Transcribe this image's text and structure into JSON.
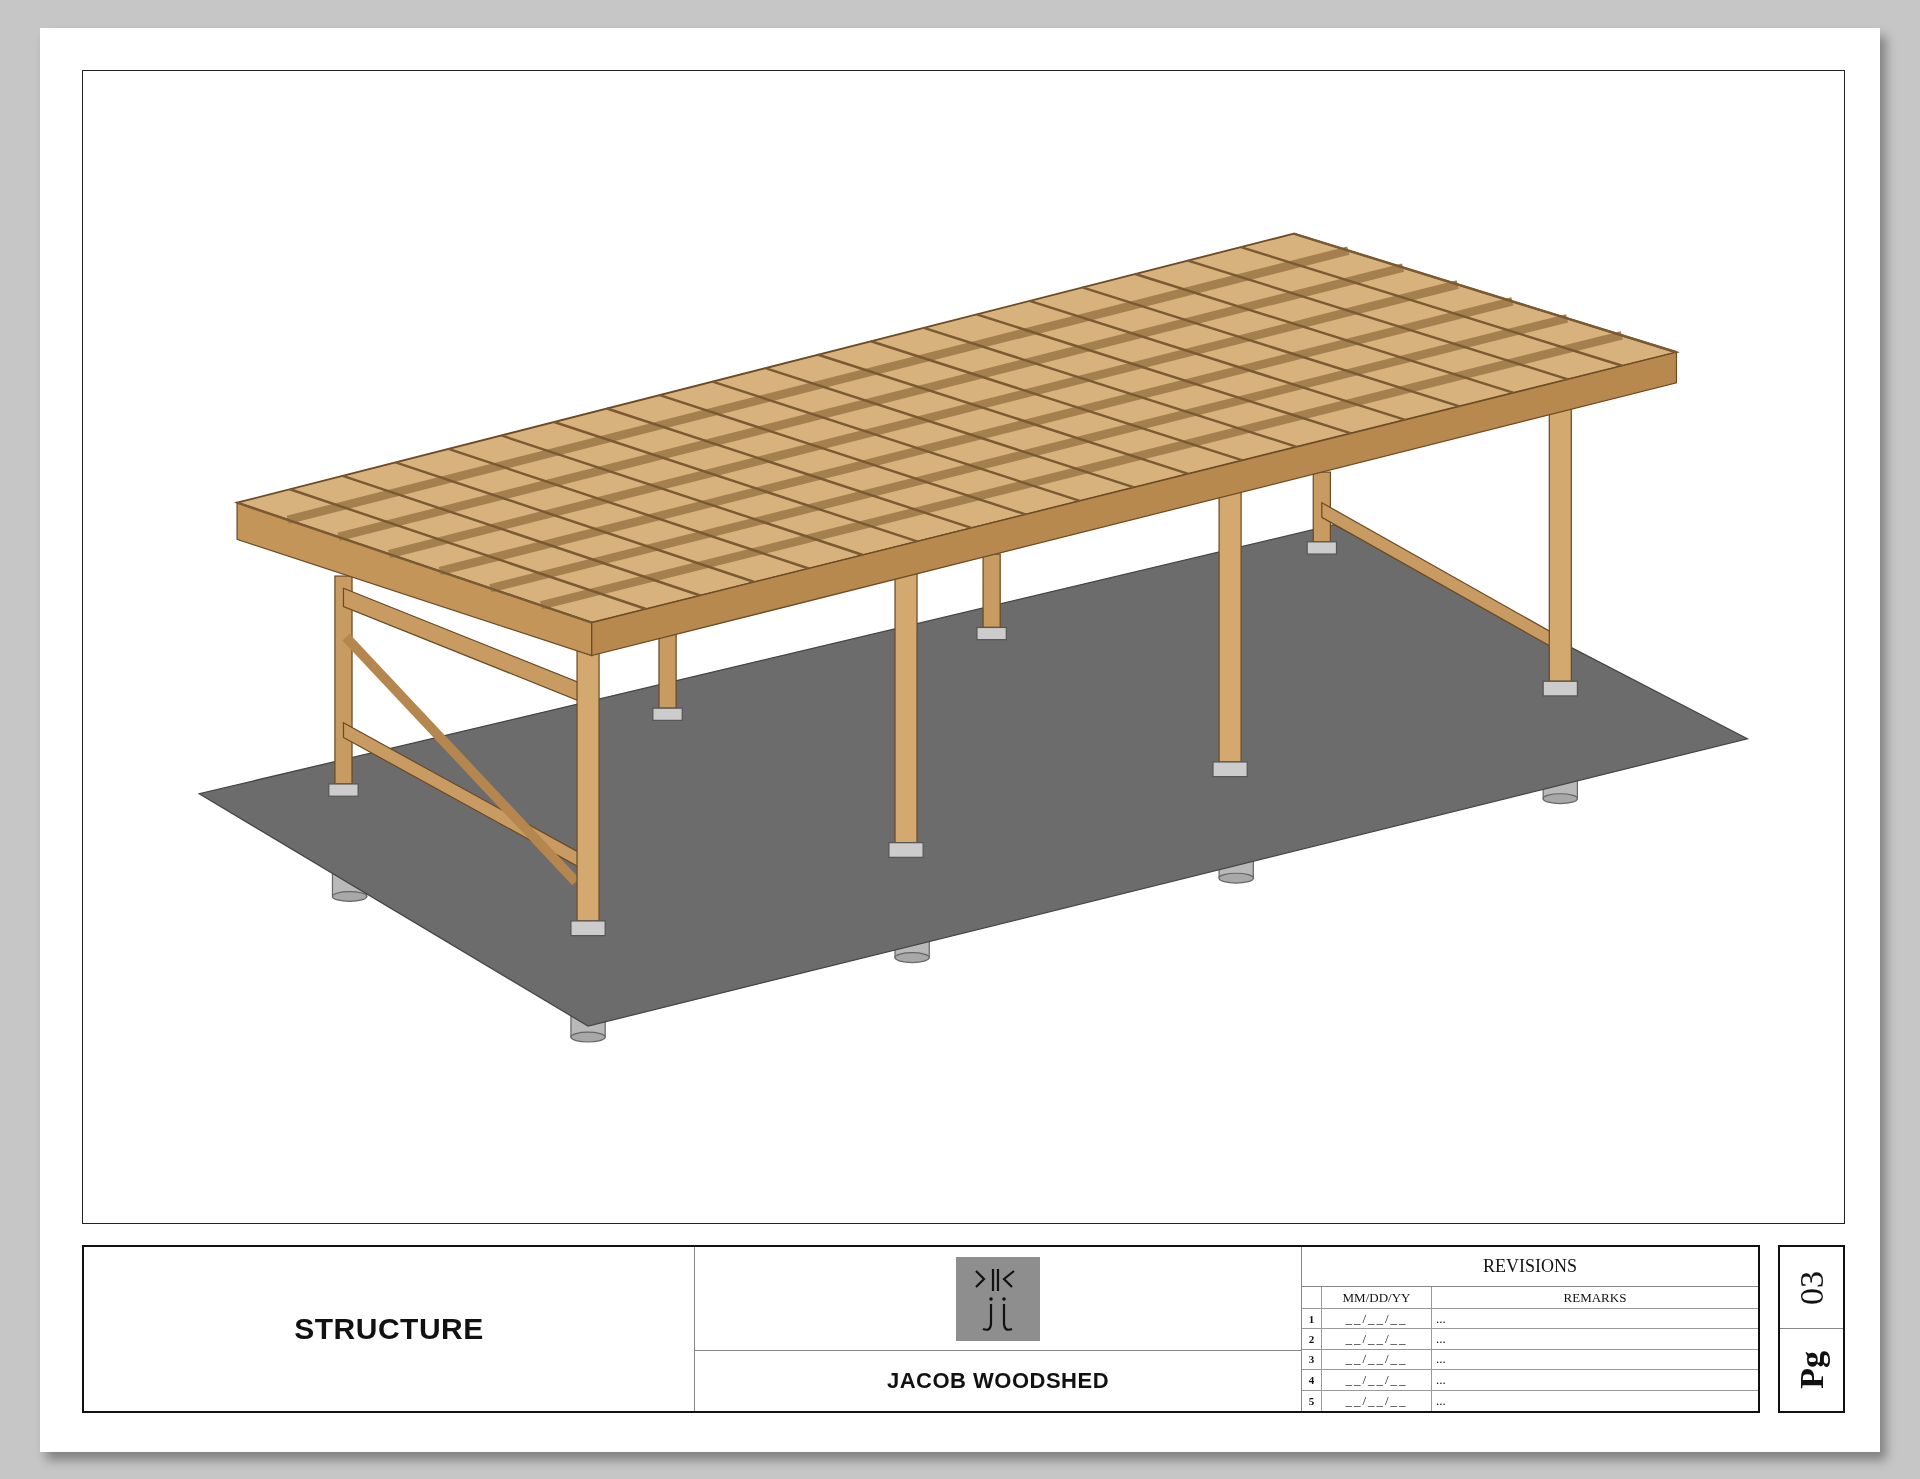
{
  "sheet": {
    "title": "STRUCTURE",
    "project": "JACOB WOODSHED",
    "revisions": {
      "title": "REVISIONS",
      "columns": [
        "MM/DD/YY",
        "REMARKS"
      ],
      "rows": [
        {
          "number": "1",
          "date": "__/__/__",
          "remarks": "..."
        },
        {
          "number": "2",
          "date": "__/__/__",
          "remarks": "..."
        },
        {
          "number": "3",
          "date": "__/__/__",
          "remarks": "..."
        },
        {
          "number": "4",
          "date": "__/__/__",
          "remarks": "..."
        },
        {
          "number": "5",
          "date": "__/__/__",
          "remarks": "..."
        }
      ]
    },
    "page": {
      "label": "Pg",
      "number": "03"
    }
  }
}
